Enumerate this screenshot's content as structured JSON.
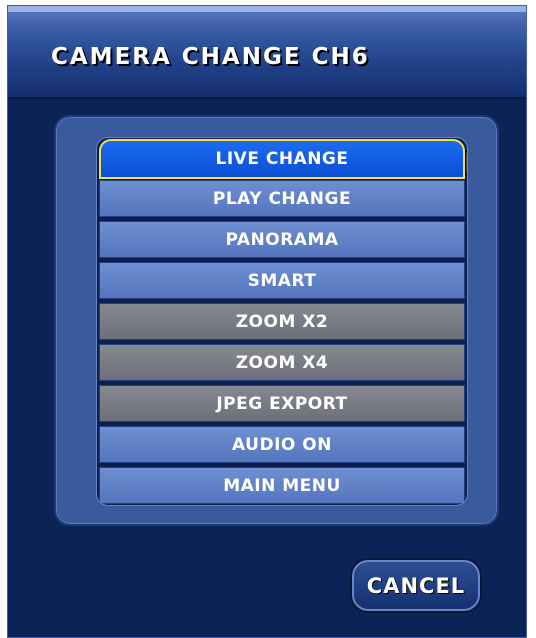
{
  "dialog": {
    "title": "CAMERA CHANGE CH6"
  },
  "menu": {
    "items": [
      {
        "label": "LIVE CHANGE",
        "state": "selected"
      },
      {
        "label": "PLAY CHANGE",
        "state": "enabled"
      },
      {
        "label": "PANORAMA",
        "state": "enabled"
      },
      {
        "label": "SMART",
        "state": "enabled"
      },
      {
        "label": "ZOOM X2",
        "state": "disabled"
      },
      {
        "label": "ZOOM X4",
        "state": "disabled"
      },
      {
        "label": "JPEG EXPORT",
        "state": "disabled"
      },
      {
        "label": "AUDIO ON",
        "state": "enabled"
      },
      {
        "label": "MAIN MENU",
        "state": "enabled"
      }
    ]
  },
  "cancel_label": "CANCEL",
  "cursor_icon": "arrow-cursor-icon",
  "colors": {
    "selected_item": "#0b4fd2",
    "selected_border": "#f3e24a",
    "enabled_item": "#5f7fc6",
    "disabled_item": "#7a7c85",
    "window_background": "#0c2455"
  }
}
